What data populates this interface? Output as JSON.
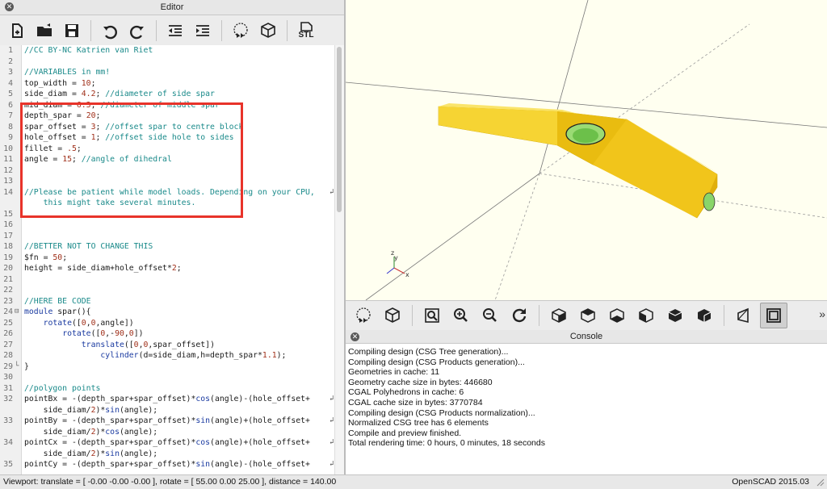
{
  "editor": {
    "title": "Editor",
    "lines": [
      {
        "n": "1",
        "parts": [
          [
            "cm",
            "//CC BY-NC Katrien van Riet"
          ]
        ]
      },
      {
        "n": "2",
        "parts": []
      },
      {
        "n": "3",
        "parts": [
          [
            "cm",
            "//VARIABLES in mm!"
          ]
        ]
      },
      {
        "n": "4",
        "parts": [
          [
            "",
            "top_width = "
          ],
          [
            "num",
            "10"
          ],
          [
            "",
            ";"
          ]
        ]
      },
      {
        "n": "5",
        "parts": [
          [
            "",
            "side_diam = "
          ],
          [
            "num",
            "4.2"
          ],
          [
            "",
            "; "
          ],
          [
            "cm",
            "//diameter of side spar"
          ]
        ]
      },
      {
        "n": "6",
        "parts": [
          [
            "",
            "mid_diam = "
          ],
          [
            "num",
            "6.3"
          ],
          [
            "",
            "; "
          ],
          [
            "cm",
            "//diameter of middle spar"
          ]
        ]
      },
      {
        "n": "7",
        "parts": [
          [
            "",
            "depth_spar = "
          ],
          [
            "num",
            "20"
          ],
          [
            "",
            ";"
          ]
        ]
      },
      {
        "n": "8",
        "parts": [
          [
            "",
            "spar_offset = "
          ],
          [
            "num",
            "3"
          ],
          [
            "",
            "; "
          ],
          [
            "cm",
            "//offset spar to centre block"
          ]
        ]
      },
      {
        "n": "9",
        "parts": [
          [
            "",
            "hole_offset = "
          ],
          [
            "num",
            "1"
          ],
          [
            "",
            "; "
          ],
          [
            "cm",
            "//offset side hole to sides"
          ]
        ]
      },
      {
        "n": "10",
        "parts": [
          [
            "",
            "fillet = "
          ],
          [
            "num",
            ".5"
          ],
          [
            "",
            ";"
          ]
        ]
      },
      {
        "n": "11",
        "parts": [
          [
            "",
            "angle = "
          ],
          [
            "num",
            "15"
          ],
          [
            "",
            "; "
          ],
          [
            "cm",
            "//angle of dihedral"
          ]
        ]
      },
      {
        "n": "12",
        "parts": []
      },
      {
        "n": "13",
        "parts": []
      },
      {
        "n": "14",
        "wrap": true,
        "parts": [
          [
            "cm",
            "//Please be patient while model loads. Depending on your CPU,"
          ]
        ]
      },
      {
        "n": "",
        "parts": [
          [
            "cm",
            "    this might take several minutes."
          ]
        ]
      },
      {
        "n": "15",
        "parts": []
      },
      {
        "n": "16",
        "parts": []
      },
      {
        "n": "17",
        "parts": []
      },
      {
        "n": "18",
        "parts": [
          [
            "cm",
            "//BETTER NOT TO CHANGE THIS"
          ]
        ]
      },
      {
        "n": "19",
        "parts": [
          [
            "",
            "$fn = "
          ],
          [
            "num",
            "50"
          ],
          [
            "",
            ";"
          ]
        ]
      },
      {
        "n": "20",
        "parts": [
          [
            "",
            "height = side_diam+hole_offset*"
          ],
          [
            "num",
            "2"
          ],
          [
            "",
            ";"
          ]
        ]
      },
      {
        "n": "21",
        "parts": []
      },
      {
        "n": "22",
        "parts": []
      },
      {
        "n": "23",
        "parts": [
          [
            "cm",
            "//HERE BE CODE"
          ]
        ]
      },
      {
        "n": "24",
        "fold": "⊟",
        "parts": [
          [
            "kw",
            "module"
          ],
          [
            "",
            " spar(){"
          ]
        ]
      },
      {
        "n": "25",
        "parts": [
          [
            "",
            "    "
          ],
          [
            "kw",
            "rotate"
          ],
          [
            "",
            "(["
          ],
          [
            "num",
            "0"
          ],
          [
            "",
            ","
          ],
          [
            "num",
            "0"
          ],
          [
            "",
            ",angle])"
          ]
        ]
      },
      {
        "n": "26",
        "parts": [
          [
            "",
            "        "
          ],
          [
            "kw",
            "rotate"
          ],
          [
            "",
            "(["
          ],
          [
            "num",
            "0"
          ],
          [
            "",
            ",-"
          ],
          [
            "num",
            "90"
          ],
          [
            "",
            ","
          ],
          [
            "num",
            "0"
          ],
          [
            "",
            "])"
          ]
        ]
      },
      {
        "n": "27",
        "parts": [
          [
            "",
            "            "
          ],
          [
            "kw",
            "translate"
          ],
          [
            "",
            "(["
          ],
          [
            "num",
            "0"
          ],
          [
            "",
            ","
          ],
          [
            "num",
            "0"
          ],
          [
            "",
            ",spar_offset])"
          ]
        ]
      },
      {
        "n": "28",
        "parts": [
          [
            "",
            "                "
          ],
          [
            "kw",
            "cylinder"
          ],
          [
            "",
            "(d=side_diam,h=depth_spar*"
          ],
          [
            "num",
            "1.1"
          ],
          [
            "",
            ");"
          ]
        ]
      },
      {
        "n": "29",
        "fold": "└",
        "parts": [
          [
            "",
            "}"
          ]
        ]
      },
      {
        "n": "30",
        "parts": []
      },
      {
        "n": "31",
        "parts": [
          [
            "cm",
            "//polygon points"
          ]
        ]
      },
      {
        "n": "32",
        "wrap": true,
        "parts": [
          [
            "",
            "pointBx = -(depth_spar+spar_offset)*"
          ],
          [
            "kw",
            "cos"
          ],
          [
            "",
            "(angle)-(hole_offset+"
          ]
        ]
      },
      {
        "n": "",
        "parts": [
          [
            "",
            "    side_diam/"
          ],
          [
            "num",
            "2"
          ],
          [
            "",
            ")*"
          ],
          [
            "kw",
            "sin"
          ],
          [
            "",
            "(angle);"
          ]
        ]
      },
      {
        "n": "33",
        "wrap": true,
        "parts": [
          [
            "",
            "pointBy = -(depth_spar+spar_offset)*"
          ],
          [
            "kw",
            "sin"
          ],
          [
            "",
            "(angle)+(hole_offset+"
          ]
        ]
      },
      {
        "n": "",
        "parts": [
          [
            "",
            "    side_diam/"
          ],
          [
            "num",
            "2"
          ],
          [
            "",
            ")*"
          ],
          [
            "kw",
            "cos"
          ],
          [
            "",
            "(angle);"
          ]
        ]
      },
      {
        "n": "34",
        "wrap": true,
        "parts": [
          [
            "",
            "pointCx = -(depth_spar+spar_offset)*"
          ],
          [
            "kw",
            "cos"
          ],
          [
            "",
            "(angle)+(hole_offset+"
          ]
        ]
      },
      {
        "n": "",
        "parts": [
          [
            "",
            "    side_diam/"
          ],
          [
            "num",
            "2"
          ],
          [
            "",
            ")*"
          ],
          [
            "kw",
            "sin"
          ],
          [
            "",
            "(angle);"
          ]
        ]
      },
      {
        "n": "35",
        "wrap": true,
        "parts": [
          [
            "",
            "pointCy = -(depth_spar+spar_offset)*"
          ],
          [
            "kw",
            "sin"
          ],
          [
            "",
            "(angle)-(hole_offset+"
          ]
        ]
      }
    ]
  },
  "toolbar_icons": [
    "new-file-icon",
    "open-folder-icon",
    "save-icon",
    "undo-icon",
    "redo-icon",
    "unindent-icon",
    "indent-icon",
    "preview-icon",
    "render-icon",
    "export-stl-icon"
  ],
  "export_stl_label": "STL",
  "view_toolbar_icons": [
    "preview-icon",
    "render-icon",
    "zoom-all-icon",
    "zoom-in-icon",
    "zoom-out-icon",
    "reset-view-icon",
    "view-right-icon",
    "view-top-icon",
    "view-bottom-icon",
    "view-left-icon",
    "view-front-icon",
    "view-back-icon",
    "perspective-icon",
    "orthogonal-icon"
  ],
  "view_more": "»",
  "console": {
    "title": "Console",
    "lines": [
      "Compiling design (CSG Tree generation)...",
      "Compiling design (CSG Products generation)...",
      "Geometries in cache: 11",
      "Geometry cache size in bytes: 446680",
      "CGAL Polyhedrons in cache: 6",
      "CGAL cache size in bytes: 3770784",
      "Compiling design (CSG Products normalization)...",
      "Normalized CSG tree has 6 elements",
      "Compile and preview finished.",
      "Total rendering time: 0 hours, 0 minutes, 18 seconds"
    ]
  },
  "status": {
    "viewport": "Viewport: translate = [ -0.00 -0.00 -0.00 ], rotate = [ 55.00 0.00 25.00 ], distance = 140.00",
    "app": "OpenSCAD 2015.03"
  },
  "axes": {
    "x": "x",
    "y": "y",
    "z": "z"
  },
  "colors": {
    "model": "#f8d21e",
    "hole": "#7fcf5a",
    "highlight": "#e8332a",
    "background": "#fffff0"
  }
}
